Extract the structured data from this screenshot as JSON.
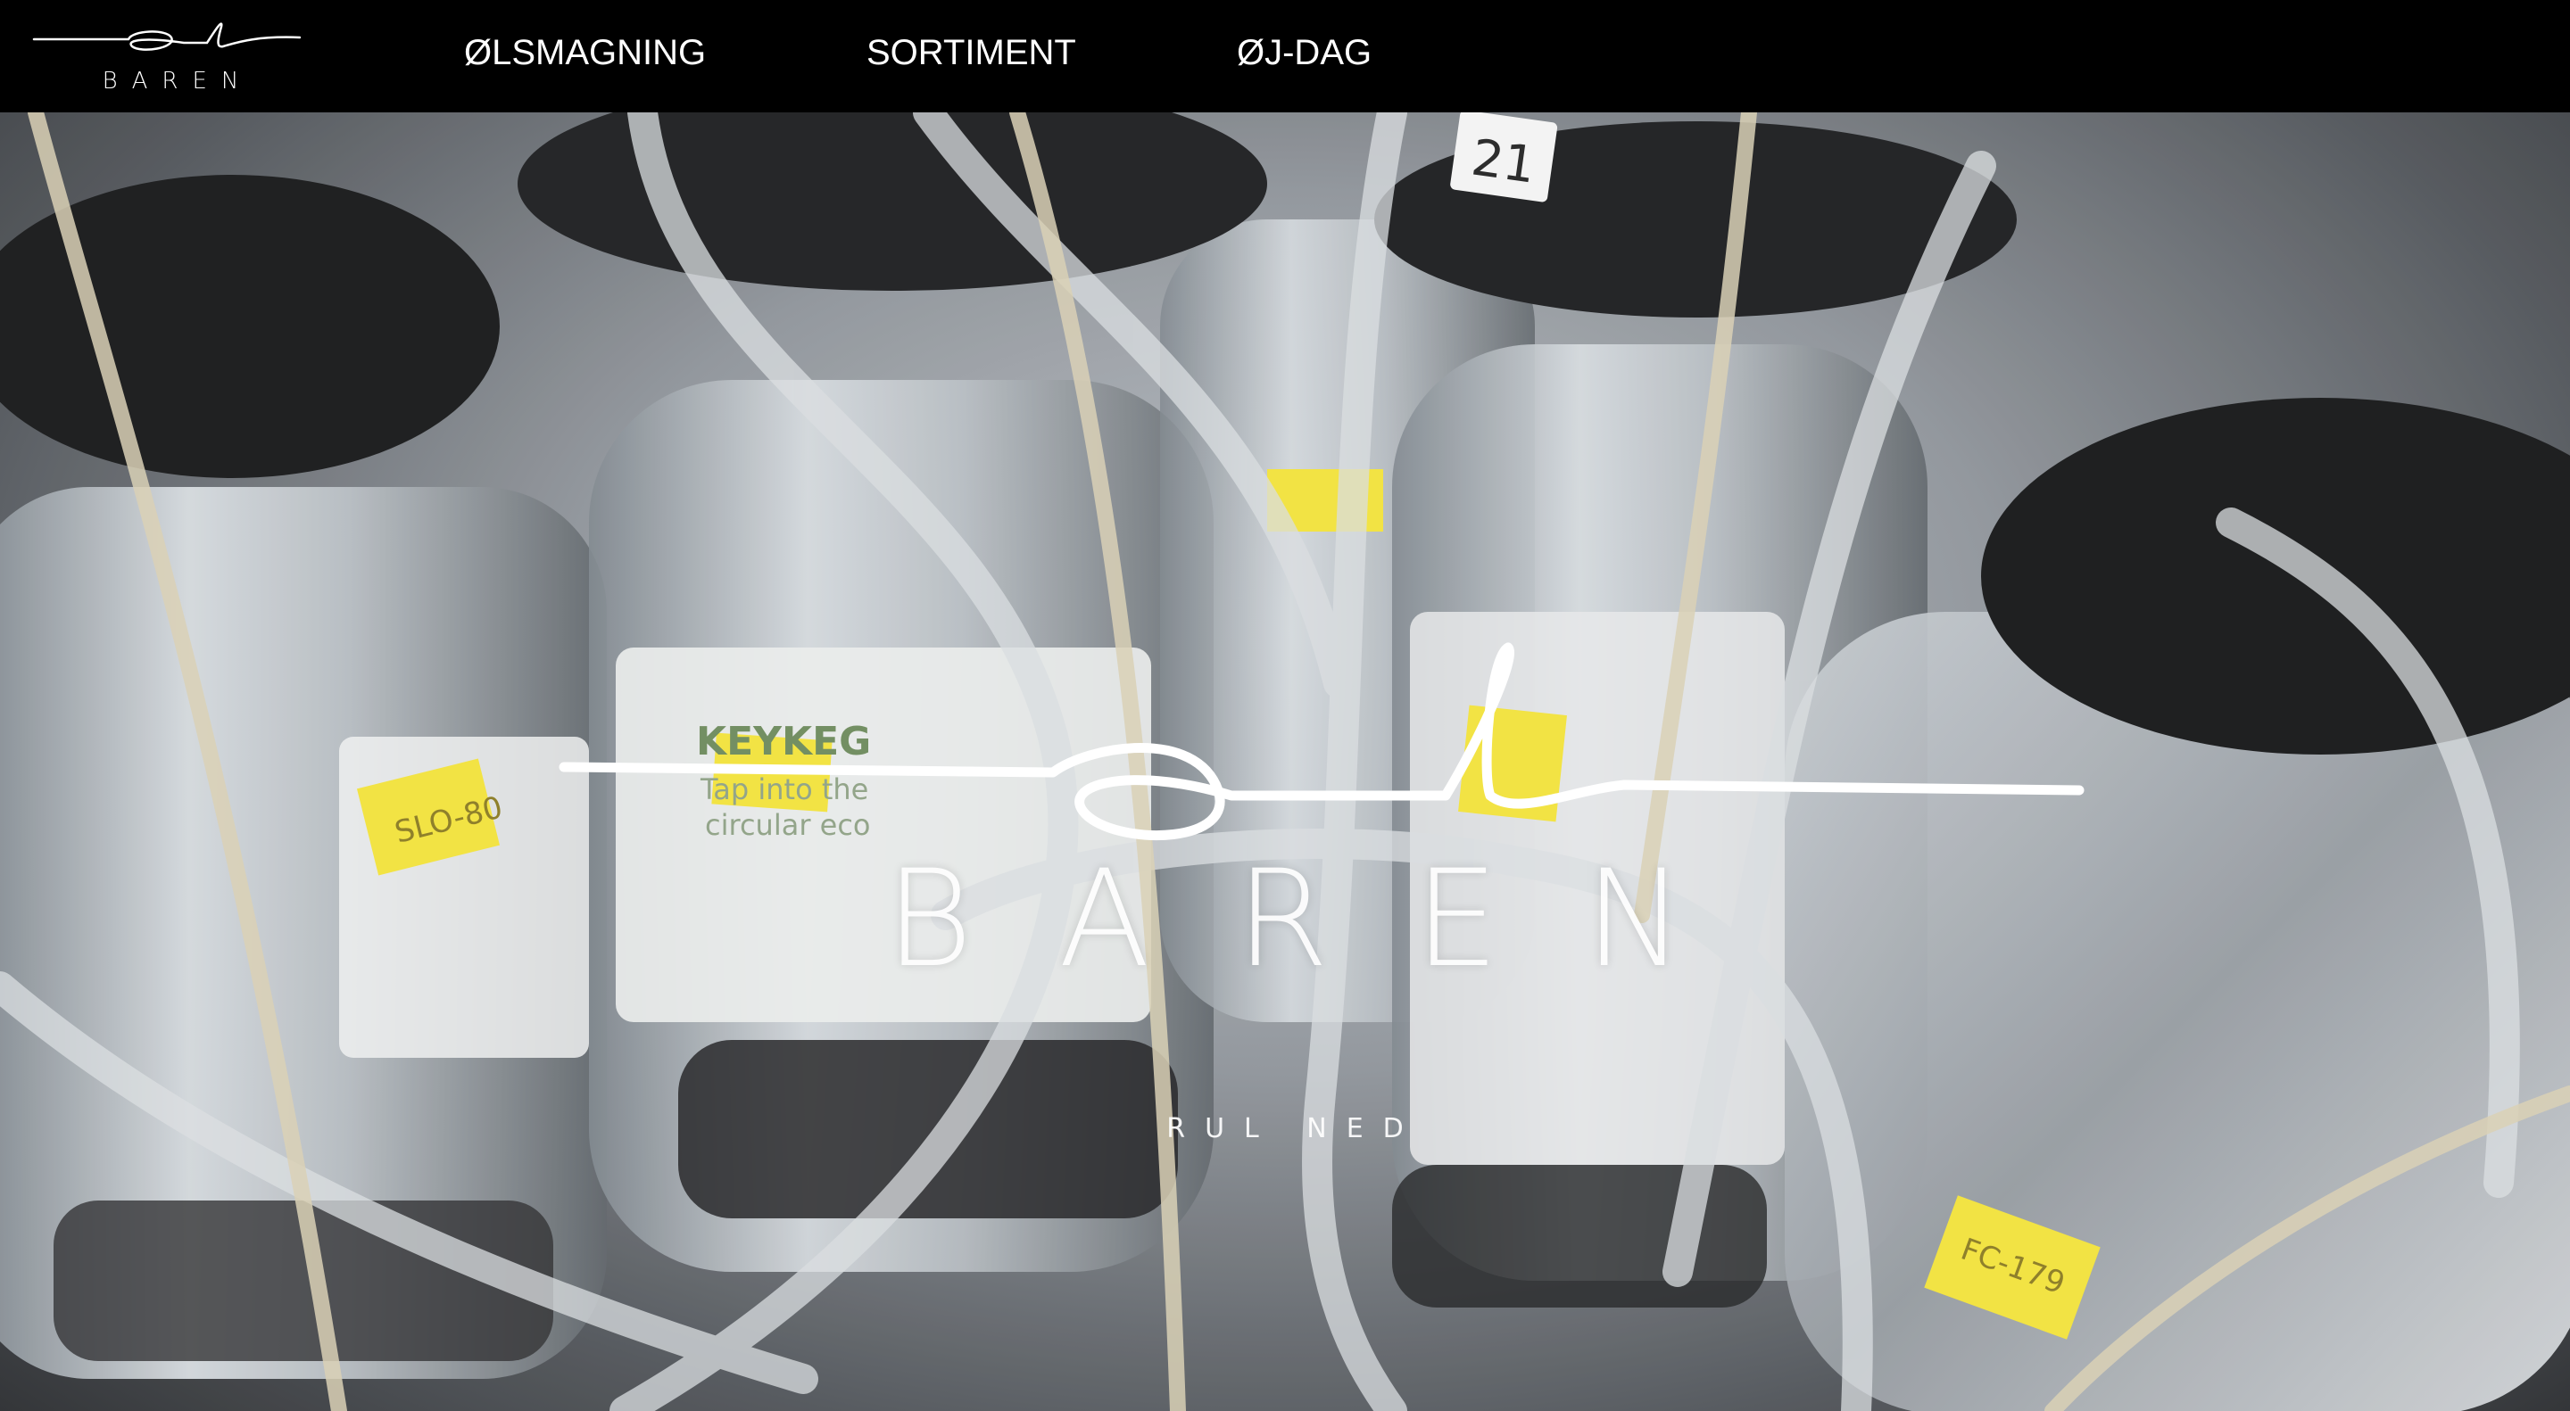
{
  "brand": {
    "logo_script": "øl",
    "logo_word": "BAREN"
  },
  "nav": {
    "items": [
      {
        "label": "ØLSMAGNING"
      },
      {
        "label": "SORTIMENT"
      },
      {
        "label": "ØJ-DAG"
      }
    ]
  },
  "hero": {
    "title": "BAREN",
    "scroll_hint": "RUL NED",
    "background": "photo-kegs-and-hoses",
    "keg_labels": [
      "KEYKEG",
      "Tap into the",
      "circular eco",
      "21",
      "SLO-80",
      "FC-179"
    ]
  },
  "colors": {
    "nav_bg": "#000000",
    "text": "#ffffff",
    "label_yellow": "#f2e23a"
  }
}
